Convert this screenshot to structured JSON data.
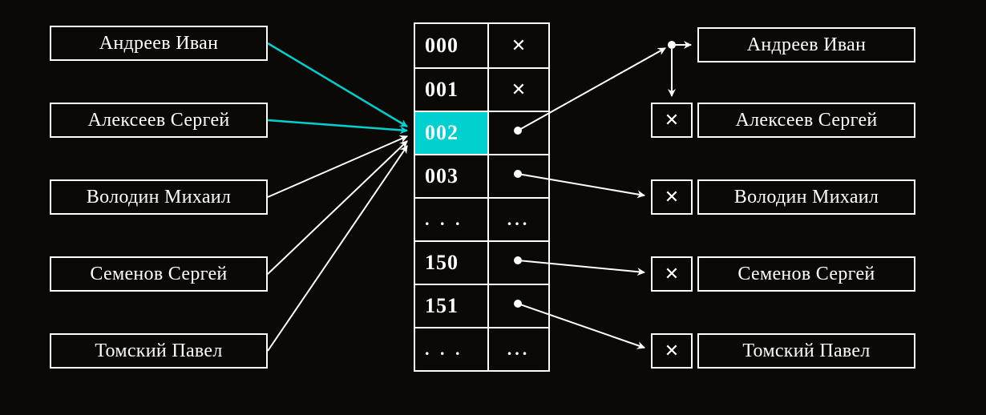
{
  "left_names": [
    {
      "label": "Андреев Иван"
    },
    {
      "label": "Алексеев Сергей"
    },
    {
      "label": "Володин Михаил"
    },
    {
      "label": "Семенов Сергей"
    },
    {
      "label": "Томский Павел"
    }
  ],
  "right_names": [
    {
      "label": "Андреев Иван",
      "has_cross": false
    },
    {
      "label": "Алексеев Сергей",
      "has_cross": true
    },
    {
      "label": "Володин Михаил",
      "has_cross": true
    },
    {
      "label": "Семенов Сергей",
      "has_cross": true
    },
    {
      "label": "Томский Павел",
      "has_cross": true
    }
  ],
  "hash_rows": [
    {
      "key": "000",
      "value": "x",
      "highlight": false
    },
    {
      "key": "001",
      "value": "x",
      "highlight": false
    },
    {
      "key": "002",
      "value": "dot",
      "highlight": true
    },
    {
      "key": "003",
      "value": "dot",
      "highlight": false
    },
    {
      "key": ". . .",
      "value": "...",
      "highlight": false
    },
    {
      "key": "150",
      "value": "dot",
      "highlight": false
    },
    {
      "key": "151",
      "value": "dot",
      "highlight": false
    },
    {
      "key": ". . .",
      "value": "...",
      "highlight": false
    }
  ],
  "colors": {
    "background": "#0b0906",
    "foreground": "#ffffff",
    "highlight": "#00d0d0"
  },
  "diagram": {
    "description": "Hash table collision / chaining illustration: five names on the left hash into slots of an 8-row table (with two names colliding at slot 002), and occupied slots point to chained record boxes on the right.",
    "left_arrows_target_row_index": 2,
    "right_pointers": [
      {
        "from_row_index": 2,
        "to_right_index": 0,
        "note": "slot 002 head -> Андреев Иван"
      },
      {
        "from_right_index": 0,
        "to_right_index": 1,
        "note": "chain -> Алексеев Сергей"
      },
      {
        "from_row_index": 3,
        "to_right_index": 2
      },
      {
        "from_row_index": 5,
        "to_right_index": 3
      },
      {
        "from_row_index": 6,
        "to_right_index": 4
      }
    ]
  }
}
